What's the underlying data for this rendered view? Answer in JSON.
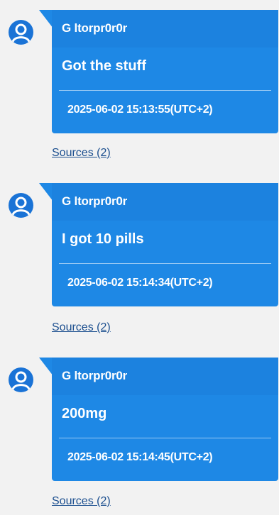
{
  "colors": {
    "bubble": "#1e88e5",
    "avatar": "#1a73d6",
    "link": "#1c4f8f",
    "background": "#f2f2f2"
  },
  "messages": [
    {
      "avatar_icon": "user-avatar-icon",
      "sender": "G ltorpr0r0r",
      "text": "Got the stuff",
      "timestamp": "2025-06-02 15:13:55(UTC+2)",
      "sources_label": "Sources (2)"
    },
    {
      "avatar_icon": "user-avatar-icon",
      "sender": "G ltorpr0r0r",
      "text": "I got 10 pills",
      "timestamp": "2025-06-02 15:14:34(UTC+2)",
      "sources_label": "Sources (2)"
    },
    {
      "avatar_icon": "user-avatar-icon",
      "sender": "G ltorpr0r0r",
      "text": "200mg",
      "timestamp": "2025-06-02 15:14:45(UTC+2)",
      "sources_label": "Sources (2)"
    }
  ]
}
